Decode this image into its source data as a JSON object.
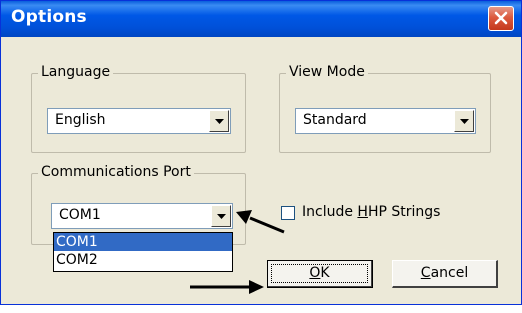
{
  "window": {
    "title": "Options",
    "close_icon": "close-icon"
  },
  "language": {
    "group_label": "Language",
    "selected": "English"
  },
  "view_mode": {
    "group_label": "View Mode",
    "selected": "Standard"
  },
  "comm_port": {
    "group_label": "Communications Port",
    "selected": "COM1",
    "options": [
      "COM1",
      "COM2"
    ],
    "highlighted_option": "COM1"
  },
  "include_hhp": {
    "label_pre": "Include ",
    "label_accel": "H",
    "label_post": "HP Strings",
    "checked": false
  },
  "buttons": {
    "ok_accel": "O",
    "ok_rest": "K",
    "cancel_accel": "C",
    "cancel_rest": "ancel"
  },
  "colors": {
    "titlebar": "#0058e6",
    "dialog_bg": "#ece9d8",
    "selection": "#316ac5",
    "close_button": "#dc5a3e"
  }
}
